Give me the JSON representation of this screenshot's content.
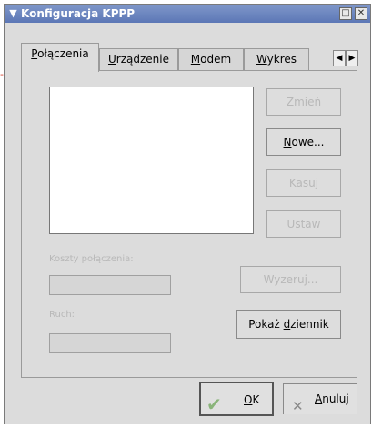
{
  "window": {
    "title": "Konfiguracja KPPP"
  },
  "tabs": [
    {
      "mnemonic": "P",
      "label_rest": "ołączenia"
    },
    {
      "mnemonic": "U",
      "label_rest": "rządzenie"
    },
    {
      "mnemonic": "M",
      "label_rest": "odem"
    },
    {
      "mnemonic": "W",
      "label_rest": "ykres"
    }
  ],
  "buttons": {
    "zmien": "Zmień",
    "nowe_mnemonic": "N",
    "nowe_rest": "owe...",
    "kasuj": "Kasuj",
    "ustaw": "Ustaw",
    "wyzeruj": "Wyzeruj...",
    "pokaz_prefix": "Pokaż ",
    "pokaz_mnemonic": "d",
    "pokaz_rest": "ziennik"
  },
  "labels": {
    "koszty": "Koszty połączenia:",
    "ruch": "Ruch:"
  },
  "bottom": {
    "ok_mnemonic": "O",
    "ok_rest": "K",
    "anuluj_mnemonic": "A",
    "anuluj_rest": "nuluj"
  },
  "icons": {
    "ok": "checkmark-icon",
    "cancel": "x-icon",
    "menu": "chevron-down-icon"
  },
  "colors": {
    "titlebar": "#6a83c0",
    "arrow": "#d23c2a"
  }
}
